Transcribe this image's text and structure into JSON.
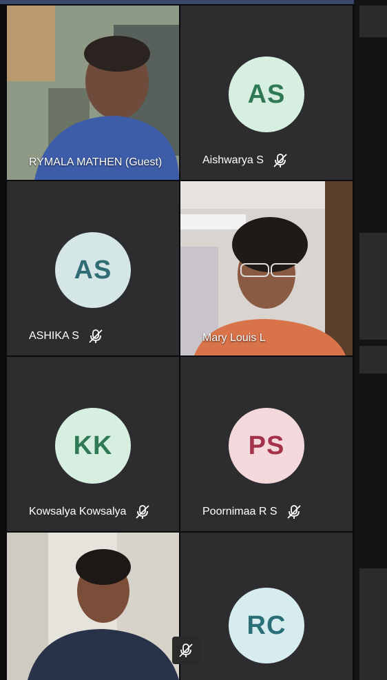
{
  "participants": [
    {
      "name": "RYMALA MATHEN (Guest)",
      "kind": "video",
      "muted": false
    },
    {
      "name": "Aishwarya S",
      "kind": "avatar",
      "initials": "AS",
      "avatar_bg": "#d6efe0",
      "avatar_fg": "#2f7a55",
      "muted": true
    },
    {
      "name": "ASHIKA  S",
      "kind": "avatar",
      "initials": "AS",
      "avatar_bg": "#d5e6e6",
      "avatar_fg": "#2f6c74",
      "muted": true
    },
    {
      "name": "Mary Louis L",
      "kind": "video",
      "muted": false
    },
    {
      "name": "Kowsalya Kowsalya",
      "kind": "avatar",
      "initials": "KK",
      "avatar_bg": "#d6efe0",
      "avatar_fg": "#2f7a55",
      "muted": true
    },
    {
      "name": "Poornimaa  R S",
      "kind": "avatar",
      "initials": "PS",
      "avatar_bg": "#f4d9dc",
      "avatar_fg": "#a3324a",
      "muted": true
    },
    {
      "name": "",
      "kind": "video",
      "muted": true
    },
    {
      "name": "",
      "kind": "avatar",
      "initials": "RC",
      "avatar_bg": "#d6ecee",
      "avatar_fg": "#2a6e78",
      "muted": false
    }
  ],
  "icons": {
    "muted": "mic-off-icon"
  },
  "colors": {
    "tile_bg": "#2d2d2f",
    "app_bg": "#0b0b0d"
  }
}
